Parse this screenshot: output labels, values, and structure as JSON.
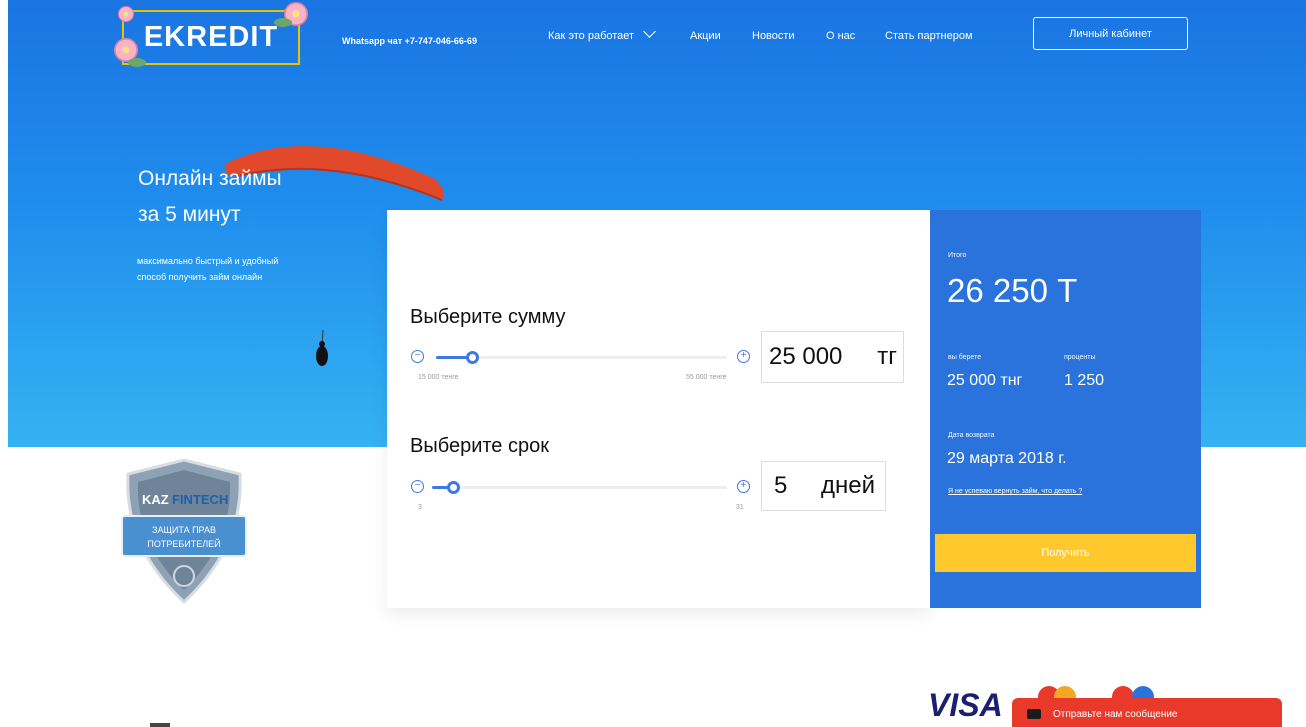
{
  "header": {
    "logo_text": "EKREDIT",
    "whatsapp": "Whatsapp чат  +7-747-046-66-69",
    "nav": {
      "how": "Как это работает",
      "promo": "Акции",
      "news": "Новости",
      "about": "О нас",
      "partner": "Стать партнером"
    },
    "cabinet_label": "Личный кабинет"
  },
  "hero": {
    "title_line1": "Онлайн займы",
    "title_line2": "за 5 минут",
    "subtitle_line1": "максимально быстрый и удобный",
    "subtitle_line2": "способ получить займ онлайн"
  },
  "calculator": {
    "amount": {
      "label": "Выберите сумму",
      "value": "25 000",
      "unit": "тг",
      "min_label": "15 000 тенге",
      "max_label": "55 000 тенге",
      "fraction": 0.125
    },
    "term": {
      "label": "Выберите срок",
      "value": "5",
      "unit": "дней",
      "min_label": "3",
      "max_label": "31",
      "fraction": 0.07
    }
  },
  "summary": {
    "total_label": "Итого",
    "total_value": "26 250 Т",
    "borrow_label": "вы берете",
    "borrow_value": "25 000 тнг",
    "interest_label": "проценты",
    "interest_value": "1 250",
    "return_label": "Дата возврата",
    "return_value": "29 марта 2018 г.",
    "help_link": "Я не успеваю вернуть займ, что делать ?",
    "cta_label": "Получить"
  },
  "badge": {
    "brand_a": "KAZ",
    "brand_b": "FINTECH",
    "line1": "ЗАЩИТА ПРАВ",
    "line2": "ПОТРЕБИТЕЛЕЙ"
  },
  "footer": {
    "visa_label": "VISA",
    "chat_label": "Отправьте нам сообщение"
  },
  "colors": {
    "accent_blue": "#2b73dc",
    "cta_yellow": "#ffc82c",
    "chat_red": "#e8392b",
    "logo_border": "#e5c400"
  }
}
